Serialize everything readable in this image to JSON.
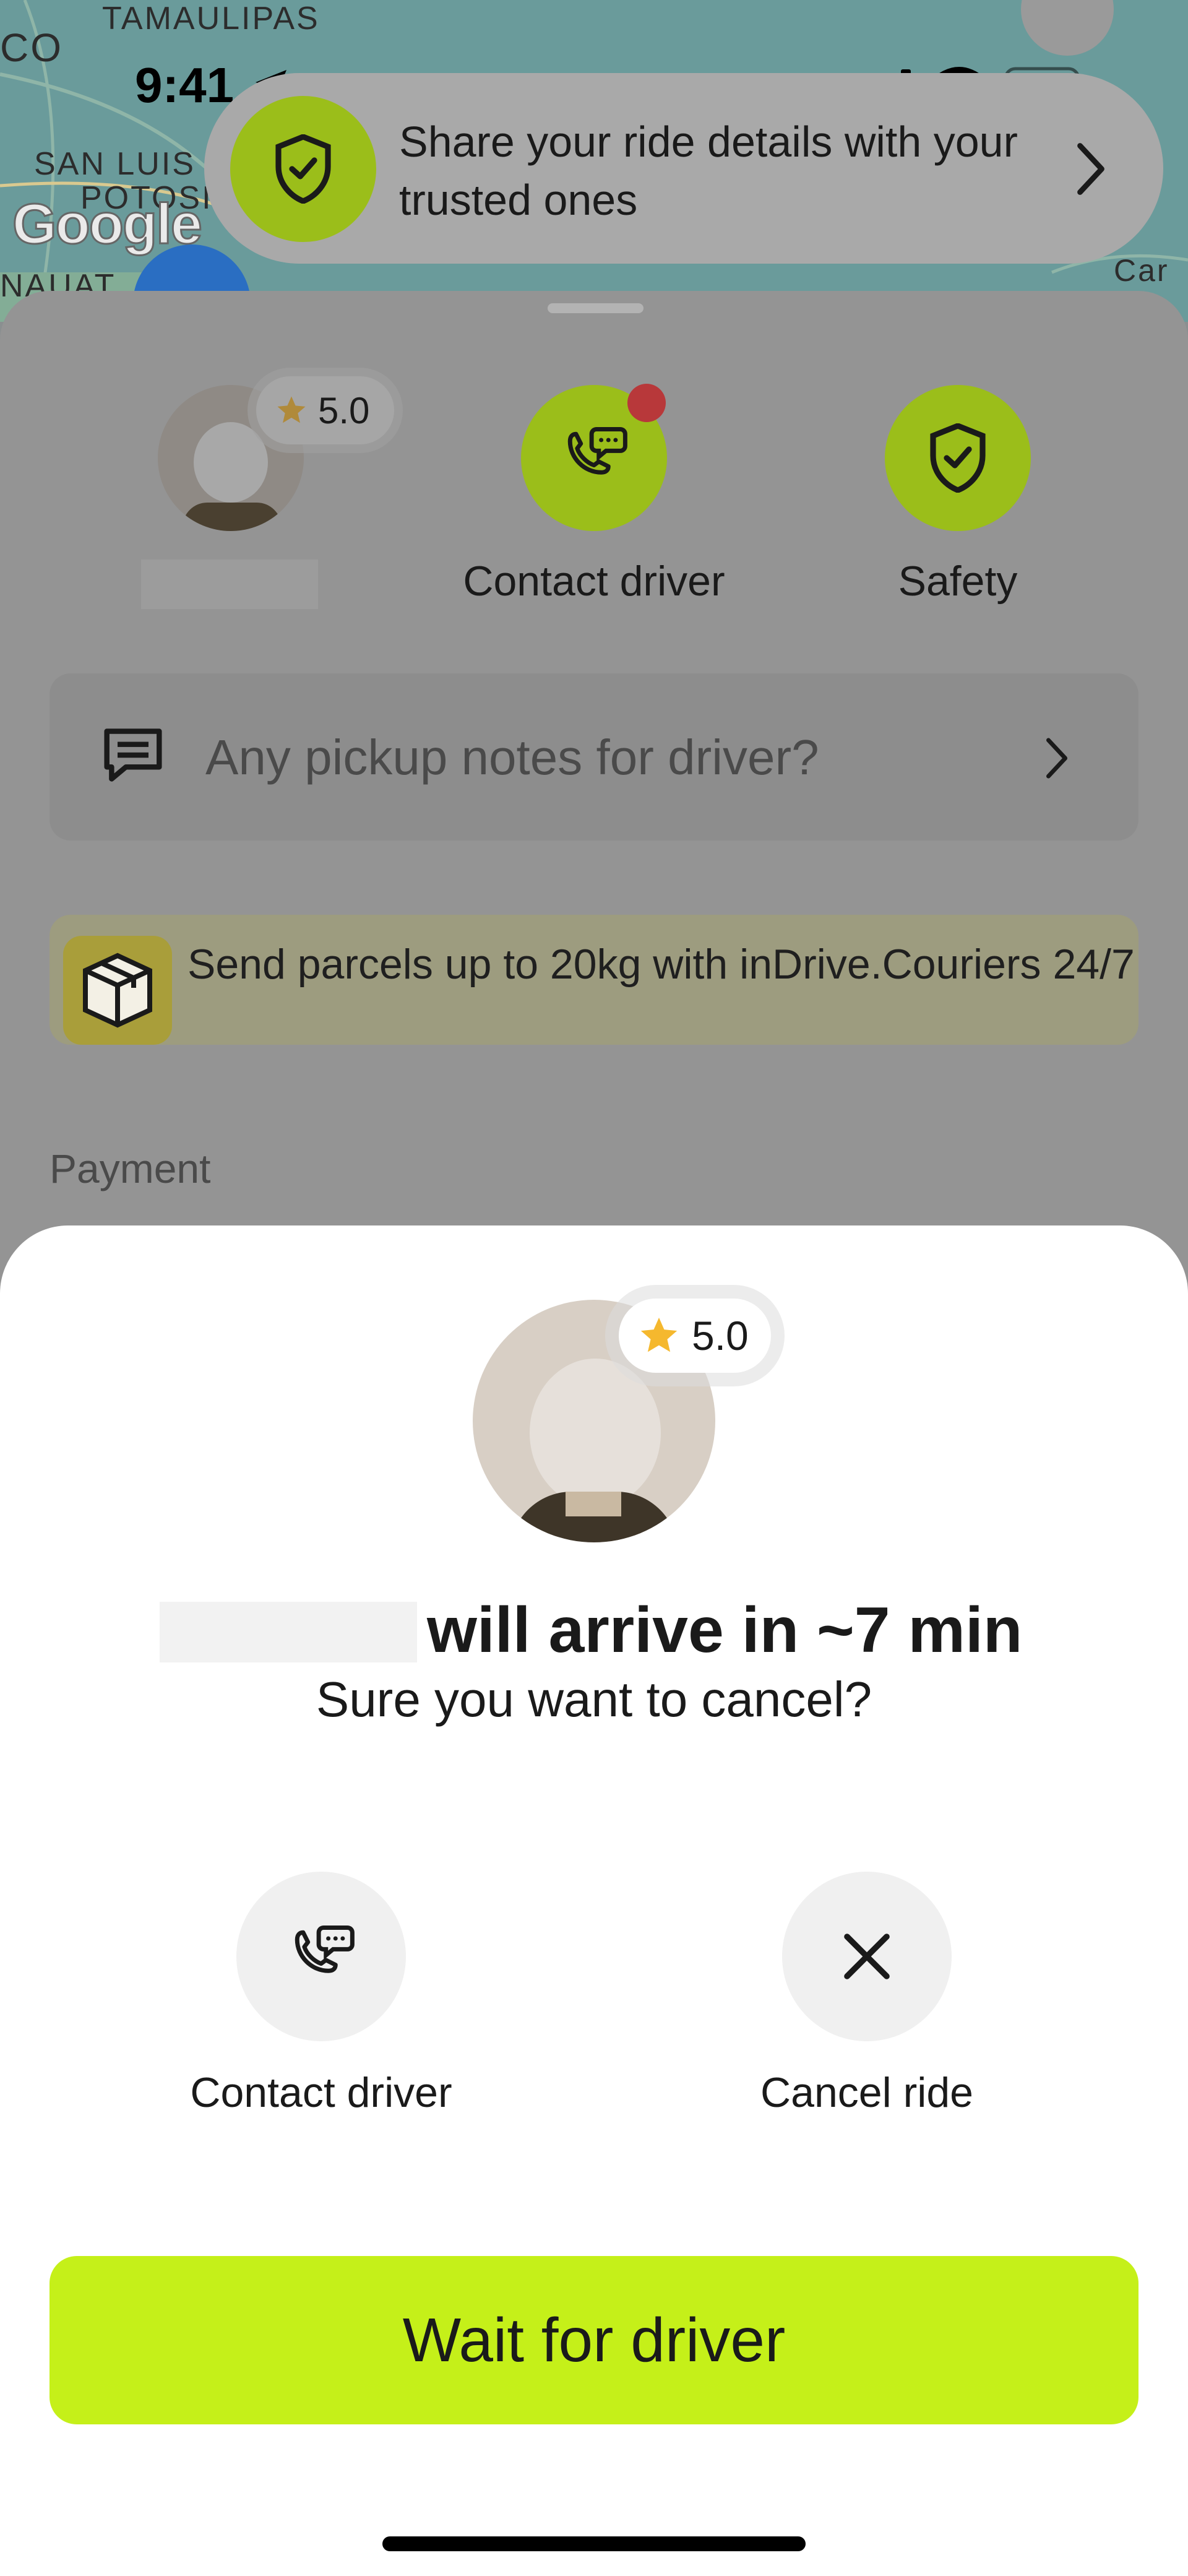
{
  "status_bar": {
    "time": "9:41"
  },
  "map": {
    "attribution": "Google",
    "labels": [
      "TAMAULIPAS",
      "SAN LUIS",
      "POTOSI",
      "NAUAT",
      "CO",
      "Car"
    ]
  },
  "share_banner": {
    "text": "Share your ride details with your trusted ones"
  },
  "driver_card": {
    "rating": "5.0",
    "contact_label": "Contact driver",
    "safety_label": "Safety"
  },
  "notes": {
    "placeholder": "Any pickup notes for driver?"
  },
  "promo": {
    "text": "Send parcels up to 20kg with inDrive.Couriers 24/7"
  },
  "payment": {
    "label": "Payment"
  },
  "modal": {
    "rating": "5.0",
    "arrival_text": "will arrive in ~7 min",
    "question": "Sure you want to cancel?",
    "contact_label": "Contact driver",
    "cancel_label": "Cancel ride",
    "wait_button": "Wait for driver"
  },
  "colors": {
    "accent": "#C5F019",
    "dimmed_accent": "#9BBE1A",
    "notification_dot": "#C0392B",
    "star": "#F5B82E"
  }
}
